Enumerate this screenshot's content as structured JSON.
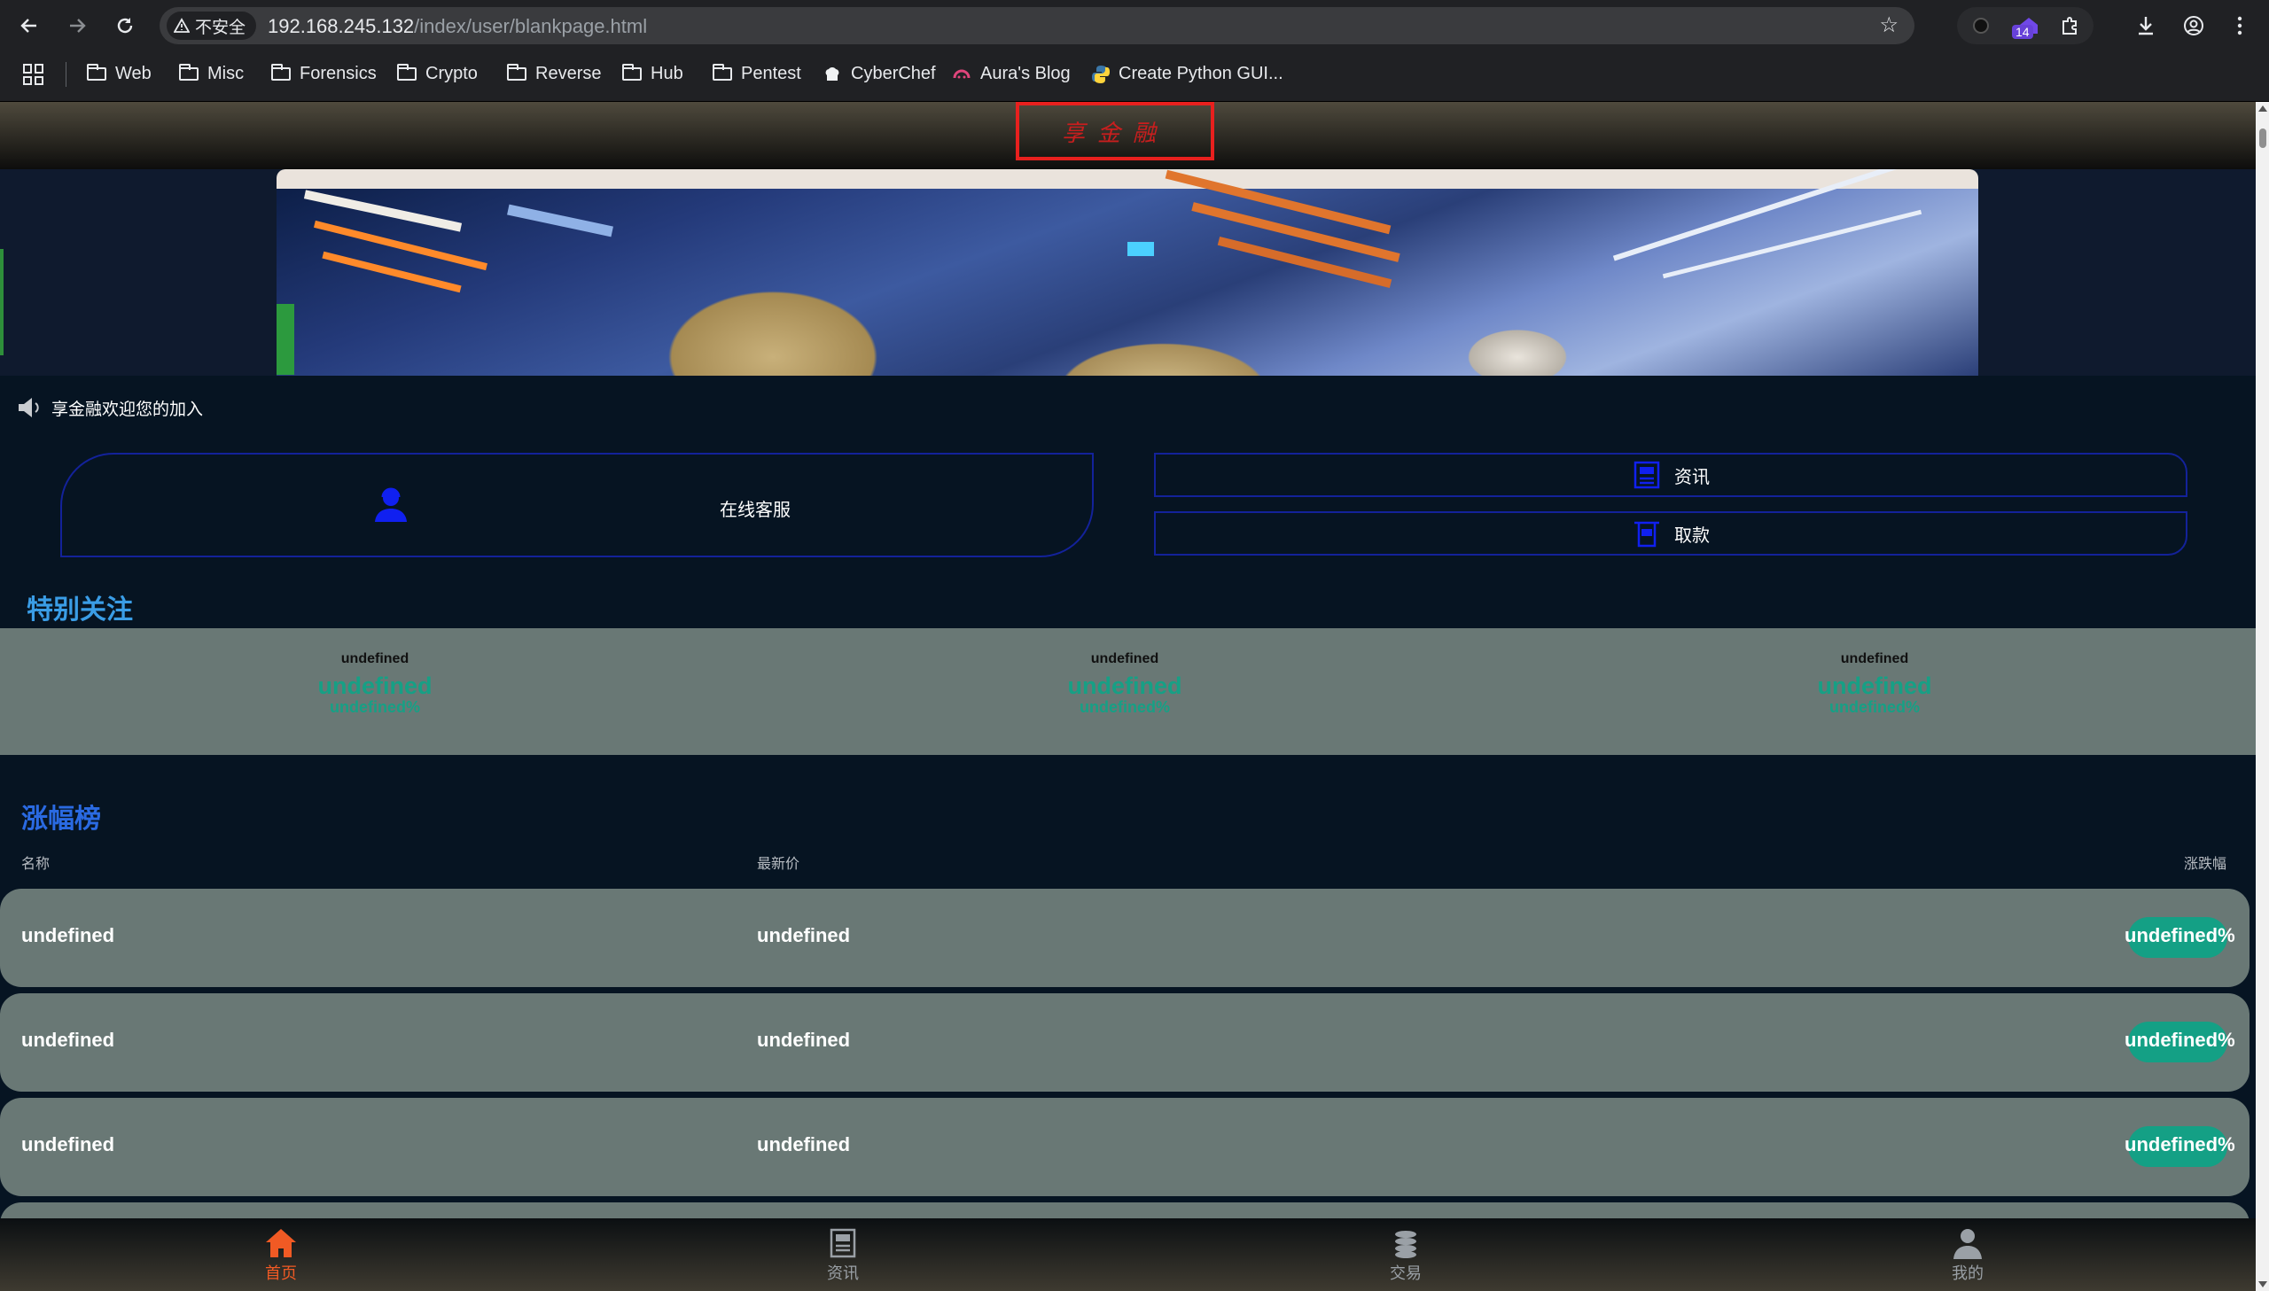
{
  "browser": {
    "security_label": "不安全",
    "url_host": "192.168.245.132",
    "url_path": "/index/user/blankpage.html",
    "extension_badge": "14",
    "bookmarks": [
      "Web",
      "Misc",
      "Forensics",
      "Crypto",
      "Reverse",
      "Hub",
      "Pentest",
      "CyberChef",
      "Aura's Blog",
      "Create Python GUI..."
    ]
  },
  "header": {
    "logo_text": "享金融"
  },
  "notice": {
    "text": "享金融欢迎您的加入"
  },
  "quick_links": {
    "customer_service": "在线客服",
    "news": "资讯",
    "withdraw": "取款"
  },
  "focus": {
    "title": "特别关注",
    "items": [
      {
        "name": "undefined",
        "price": "undefined",
        "change": "undefined%"
      },
      {
        "name": "undefined",
        "price": "undefined",
        "change": "undefined%"
      },
      {
        "name": "undefined",
        "price": "undefined",
        "change": "undefined%"
      }
    ]
  },
  "gainers": {
    "title": "涨幅榜",
    "columns": {
      "name": "名称",
      "price": "最新价",
      "change": "涨跌幅"
    },
    "rows": [
      {
        "name": "undefined",
        "price": "undefined",
        "change": "undefined%"
      },
      {
        "name": "undefined",
        "price": "undefined",
        "change": "undefined%"
      },
      {
        "name": "undefined",
        "price": "undefined",
        "change": "undefined%"
      }
    ]
  },
  "tabbar": {
    "home": "首页",
    "news": "资讯",
    "trade": "交易",
    "mine": "我的"
  },
  "colors": {
    "accent_focus_title": "#3a9de6",
    "accent_gain_title": "#2a6ae2",
    "positive": "#14a085",
    "active_tab": "#f15a24",
    "logo_border": "#e8201e"
  }
}
